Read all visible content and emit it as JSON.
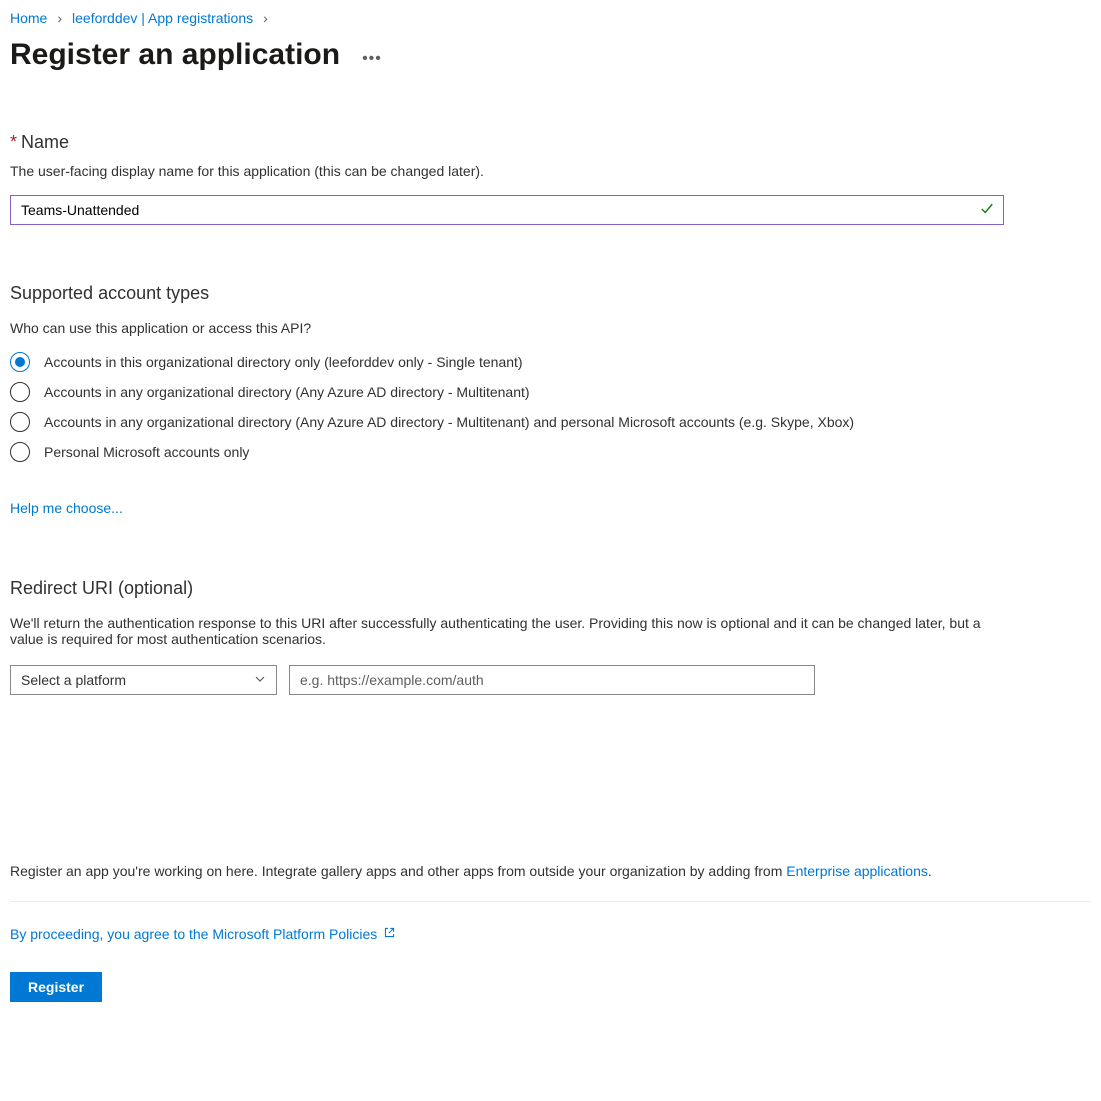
{
  "breadcrumb": {
    "home": "Home",
    "path": "leeforddev | App registrations"
  },
  "page_title": "Register an application",
  "name_section": {
    "label": "Name",
    "help": "The user-facing display name for this application (this can be changed later).",
    "value": "Teams-Unattended"
  },
  "account_types": {
    "title": "Supported account types",
    "subtext": "Who can use this application or access this API?",
    "options": [
      "Accounts in this organizational directory only (leeforddev only - Single tenant)",
      "Accounts in any organizational directory (Any Azure AD directory - Multitenant)",
      "Accounts in any organizational directory (Any Azure AD directory - Multitenant) and personal Microsoft accounts (e.g. Skype, Xbox)",
      "Personal Microsoft accounts only"
    ],
    "help_link": "Help me choose..."
  },
  "redirect": {
    "title": "Redirect URI (optional)",
    "desc": "We'll return the authentication response to this URI after successfully authenticating the user. Providing this now is optional and it can be changed later, but a value is required for most authentication scenarios.",
    "platform_placeholder": "Select a platform",
    "uri_placeholder": "e.g. https://example.com/auth"
  },
  "footer": {
    "text_prefix": "Register an app you're working on here. Integrate gallery apps and other apps from outside your organization by adding from ",
    "link": "Enterprise applications",
    "period": ".",
    "policies": "By proceeding, you agree to the Microsoft Platform Policies",
    "register_btn": "Register"
  }
}
